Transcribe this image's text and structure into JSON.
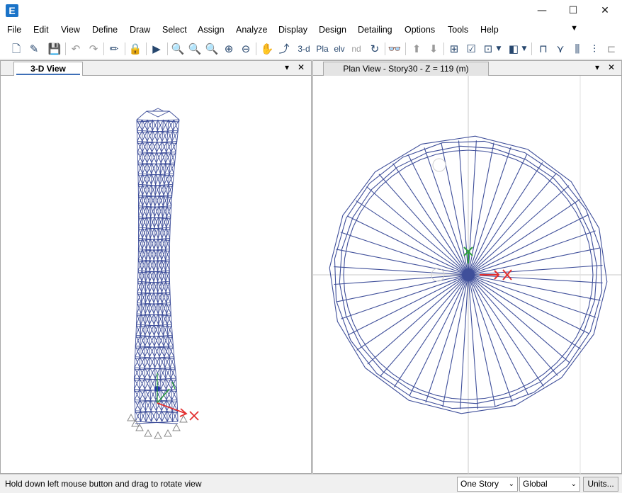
{
  "app": {
    "logo_letter": "E"
  },
  "window_controls": {
    "minimize": "—",
    "maximize": "☐",
    "close": "✕"
  },
  "menu": {
    "items": [
      "File",
      "Edit",
      "View",
      "Define",
      "Draw",
      "Select",
      "Assign",
      "Analyze",
      "Display",
      "Design",
      "Detailing",
      "Options",
      "Tools",
      "Help"
    ],
    "more": "▼"
  },
  "toolbar": {
    "view_3d": "3-d",
    "view_plan": "Pla",
    "view_elev": "elv",
    "view_nd": "nd"
  },
  "left_pane": {
    "tab_label": "3-D View",
    "dropdown_icon": "▾",
    "close_icon": "✕"
  },
  "right_pane": {
    "tab_label": "Plan View - Story30 - Z = 119 (m)",
    "dropdown_icon": "▾",
    "close_icon": "✕"
  },
  "statusbar": {
    "message": "Hold down left mouse button and drag to rotate view",
    "story_option": "One Story",
    "coord_option": "Global",
    "units_button": "Units..."
  },
  "colors": {
    "model_lines": "#3f4f9a",
    "axis_x": "#e22f2f",
    "axis_y": "#2e9e3e",
    "support": "#8a8a8a",
    "grid": "#c8c8c8"
  }
}
